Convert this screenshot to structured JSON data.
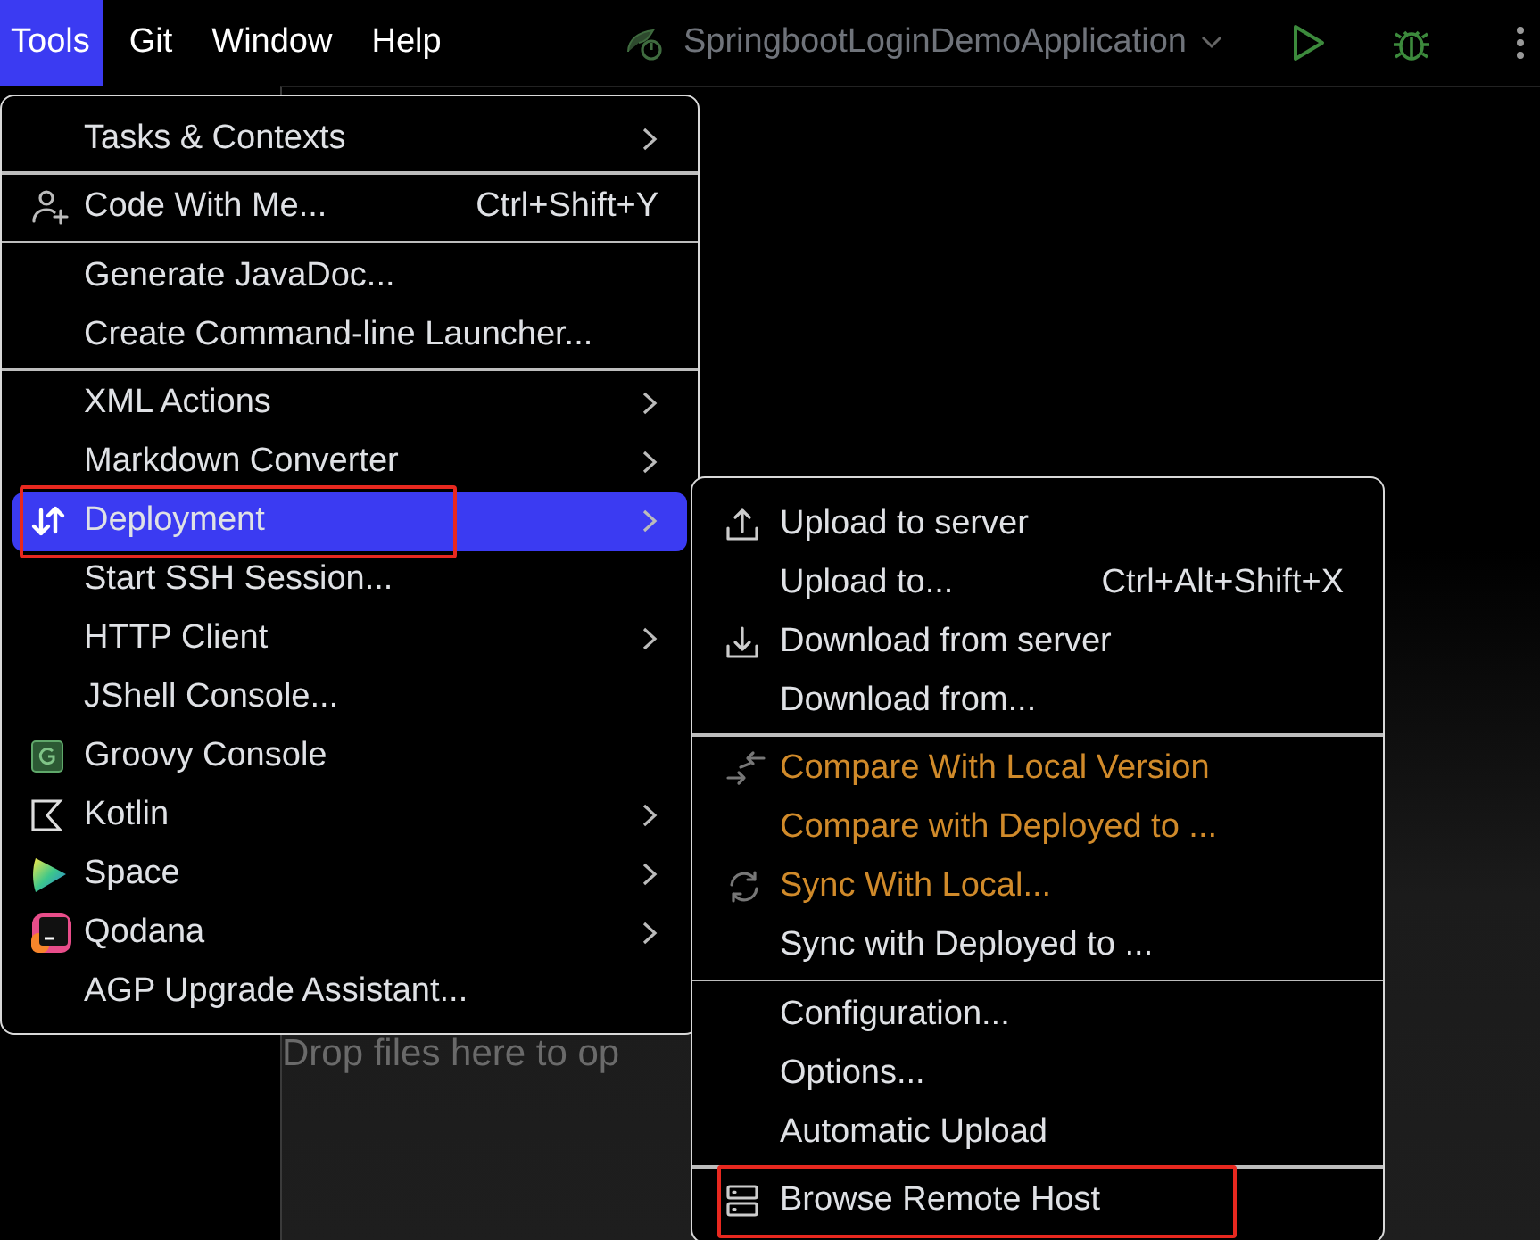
{
  "menu_bar": {
    "items": [
      {
        "label": "Tools",
        "selected": true
      },
      {
        "label": "Git",
        "selected": false
      },
      {
        "label": "Window",
        "selected": false
      },
      {
        "label": "Help",
        "selected": false
      }
    ]
  },
  "run_toolbar": {
    "configuration": "SpringbootLoginDemoApplication"
  },
  "editor": {
    "hint": "Drop files here to op"
  },
  "tools_menu": {
    "sections": [
      [
        {
          "label": "Tasks & Contexts",
          "kind": "plain",
          "submenu": true,
          "selected": false,
          "highlighted": false
        }
      ],
      [
        {
          "label": "Code With Me...",
          "shortcut": "Ctrl+Shift+Y",
          "kind": "person",
          "submenu": false,
          "selected": false,
          "highlighted": false
        }
      ],
      [
        {
          "label": "Generate JavaDoc...",
          "kind": "plain",
          "submenu": false,
          "selected": false,
          "highlighted": false
        },
        {
          "label": "Create Command-line Launcher...",
          "kind": "plain",
          "submenu": false,
          "selected": false,
          "highlighted": false
        }
      ],
      [
        {
          "label": "XML Actions",
          "kind": "plain",
          "submenu": true,
          "selected": false,
          "highlighted": false
        },
        {
          "label": "Markdown Converter",
          "kind": "plain",
          "submenu": true,
          "selected": false,
          "highlighted": false
        },
        {
          "label": "Deployment",
          "kind": "transfer",
          "submenu": true,
          "selected": true,
          "highlighted": true
        },
        {
          "label": "Start SSH Session...",
          "kind": "plain",
          "submenu": false,
          "selected": false,
          "highlighted": false
        },
        {
          "label": "HTTP Client",
          "kind": "plain",
          "submenu": true,
          "selected": false,
          "highlighted": false
        },
        {
          "label": "JShell Console...",
          "kind": "plain",
          "submenu": false,
          "selected": false,
          "highlighted": false
        },
        {
          "label": "Groovy Console",
          "kind": "groovy",
          "submenu": false,
          "selected": false,
          "highlighted": false
        },
        {
          "label": "Kotlin",
          "kind": "kotlin",
          "submenu": true,
          "selected": false,
          "highlighted": false
        },
        {
          "label": "Space",
          "kind": "space",
          "submenu": true,
          "selected": false,
          "highlighted": false
        },
        {
          "label": "Qodana",
          "kind": "qodana",
          "submenu": true,
          "selected": false,
          "highlighted": false
        },
        {
          "label": "AGP Upgrade Assistant...",
          "kind": "plain",
          "submenu": false,
          "selected": false,
          "highlighted": false
        }
      ]
    ]
  },
  "deployment_menu": {
    "sections": [
      [
        {
          "label": "Upload to server",
          "kind": "upload",
          "color": "#dfe1e5",
          "highlighted": false
        },
        {
          "label": "Upload to...",
          "shortcut": "Ctrl+Alt+Shift+X",
          "kind": "plain",
          "color": "#dfe1e5",
          "highlighted": false
        },
        {
          "label": "Download from server",
          "kind": "download",
          "color": "#dfe1e5",
          "highlighted": false
        },
        {
          "label": "Download from...",
          "kind": "plain",
          "color": "#dfe1e5",
          "highlighted": false
        }
      ],
      [
        {
          "label": "Compare With Local Version",
          "kind": "compare",
          "color": "#d08a2a",
          "highlighted": false
        },
        {
          "label": "Compare with Deployed to ...",
          "kind": "plain",
          "color": "#d08a2a",
          "highlighted": false
        },
        {
          "label": "Sync With Local...",
          "kind": "sync",
          "color": "#d08a2a",
          "highlighted": false
        },
        {
          "label": "Sync with Deployed to ...",
          "kind": "plain",
          "color": "#dfe1e5",
          "highlighted": false
        }
      ],
      [
        {
          "label": "Configuration...",
          "kind": "plain",
          "color": "#dfe1e5",
          "highlighted": false
        },
        {
          "label": "Options...",
          "kind": "plain",
          "color": "#dfe1e5",
          "highlighted": false
        },
        {
          "label": "Automatic Upload",
          "kind": "plain",
          "color": "#dfe1e5",
          "highlighted": false
        }
      ],
      [
        {
          "label": "Browse Remote Host",
          "kind": "server",
          "color": "#dfe1e5",
          "highlighted": true
        }
      ]
    ]
  }
}
